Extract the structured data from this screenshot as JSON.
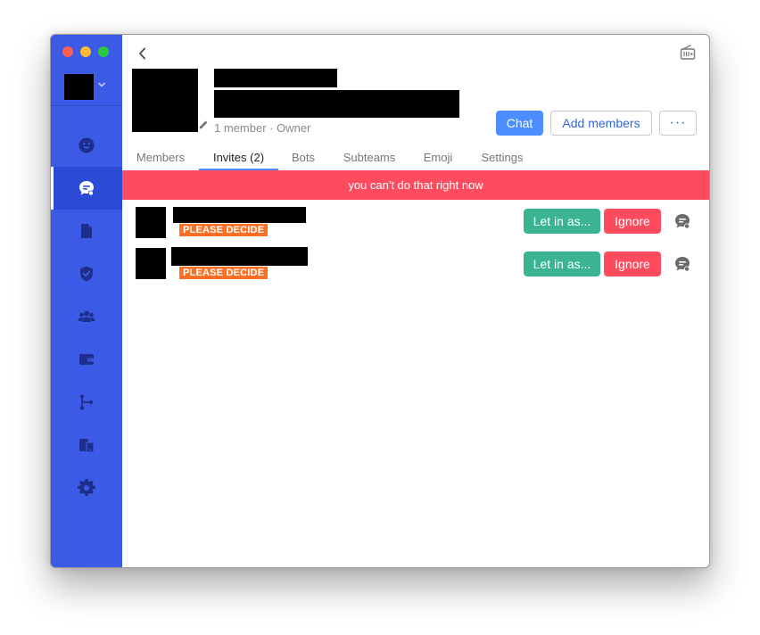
{
  "team": {
    "member_info": "1 member · Owner"
  },
  "header": {
    "chat_label": "Chat",
    "add_members_label": "Add members",
    "more_label": "···"
  },
  "tabs": [
    {
      "label": "Members"
    },
    {
      "label": "Invites (2)",
      "active": true
    },
    {
      "label": "Bots"
    },
    {
      "label": "Subteams"
    },
    {
      "label": "Emoji"
    },
    {
      "label": "Settings"
    }
  ],
  "banner": {
    "text": "you can't do that right now"
  },
  "invites": [
    {
      "badge": "PLEASE DECIDE",
      "let_in_label": "Let in as...",
      "ignore_label": "Ignore"
    },
    {
      "badge": "PLEASE DECIDE",
      "let_in_label": "Let in as...",
      "ignore_label": "Ignore"
    }
  ],
  "sidebar": {
    "items": [
      {
        "icon": "people-icon"
      },
      {
        "icon": "chat-icon",
        "active": true
      },
      {
        "icon": "file-icon"
      },
      {
        "icon": "shield-icon"
      },
      {
        "icon": "teams-icon"
      },
      {
        "icon": "wallet-icon"
      },
      {
        "icon": "git-icon"
      },
      {
        "icon": "devices-icon"
      },
      {
        "icon": "gear-icon"
      }
    ]
  },
  "colors": {
    "sidebar": "#3b5be6",
    "accent": "#4c8eff",
    "danger": "#ff4b5e",
    "success": "#3bb591",
    "badge": "#ff6f21"
  }
}
